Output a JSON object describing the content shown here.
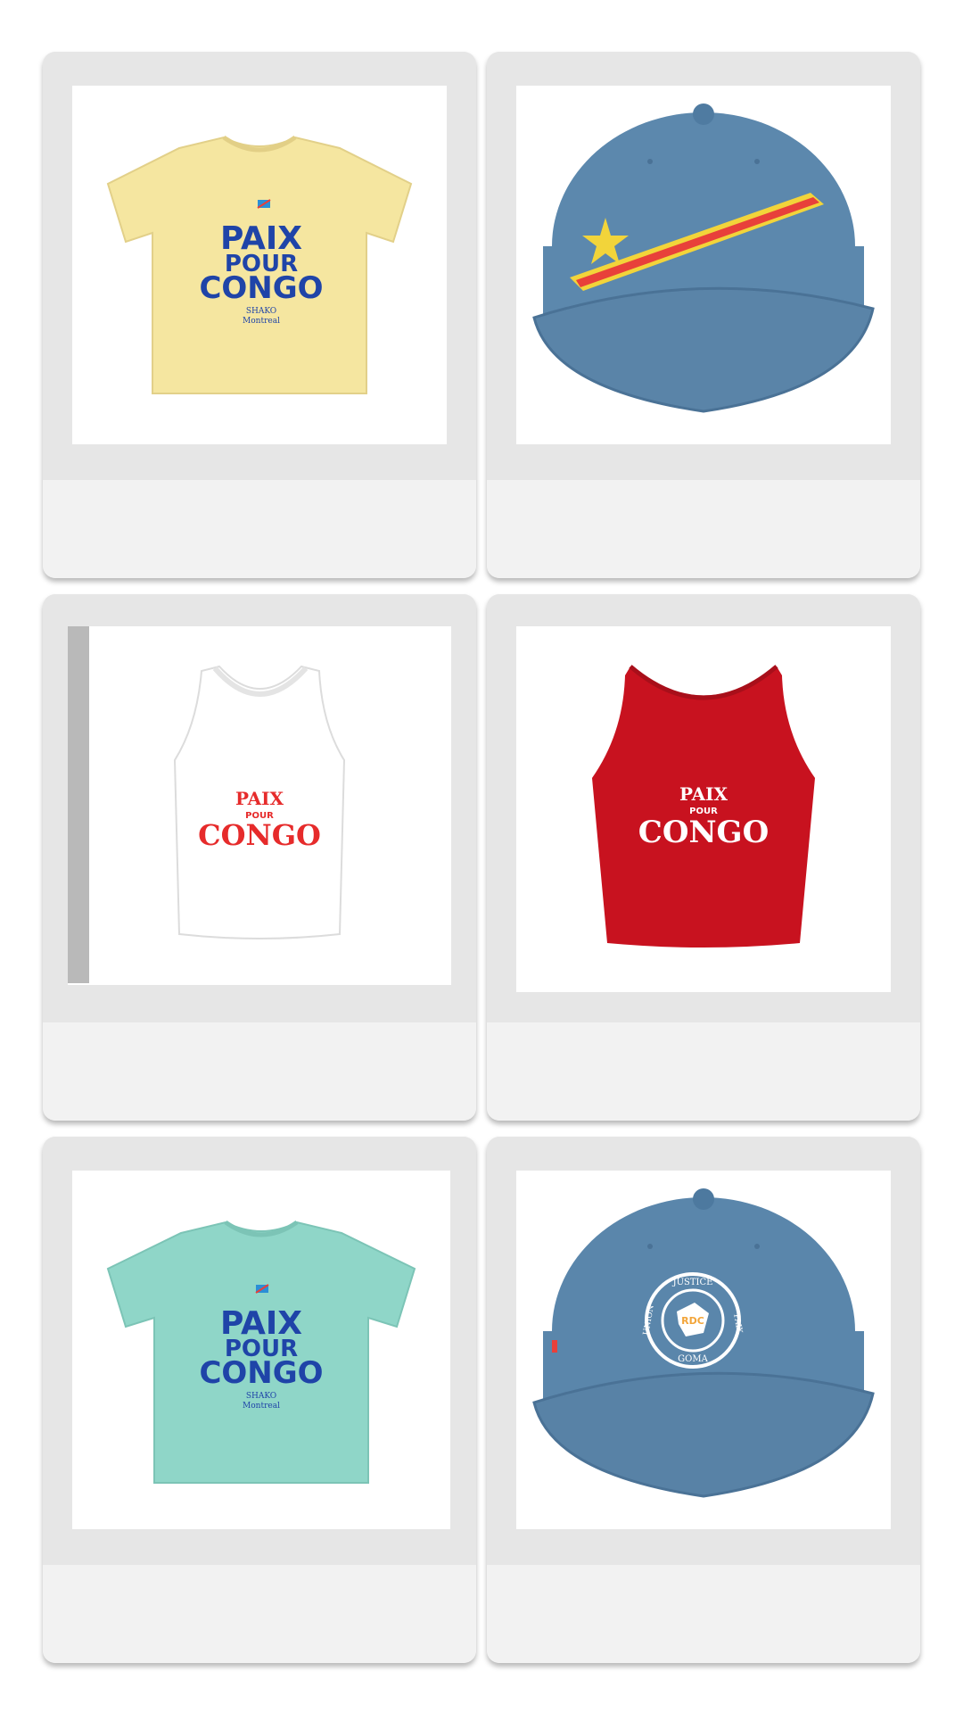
{
  "products": [
    {
      "kind": "crop-tee",
      "color": "#f5e6a0",
      "print_color": "#1f44a8",
      "print": [
        "PAIX",
        "POUR",
        "CONGO"
      ],
      "subprint": [
        "SHAKO",
        "Montreal"
      ]
    },
    {
      "kind": "cap-flag",
      "color": "#5c88ad",
      "accent_red": "#e8403a",
      "accent_yellow": "#f2d43a"
    },
    {
      "kind": "tank",
      "color": "#ffffff",
      "print_color": "#e62b2b",
      "print": [
        "PAIX",
        "POUR",
        "CONGO"
      ]
    },
    {
      "kind": "tank",
      "color": "#c8121f",
      "print_color": "#ffffff",
      "print": [
        "PAIX",
        "POUR",
        "CONGO"
      ]
    },
    {
      "kind": "crop-tee",
      "color": "#8fd6c8",
      "print_color": "#1f44a8",
      "print": [
        "PAIX",
        "POUR",
        "CONGO"
      ],
      "subprint": [
        "SHAKO",
        "Montreal"
      ]
    },
    {
      "kind": "cap-seal",
      "color": "#5a86ab",
      "seal": [
        "JUSTICE",
        "PAIX",
        "GOMA",
        "UNION",
        "RDC"
      ]
    }
  ]
}
